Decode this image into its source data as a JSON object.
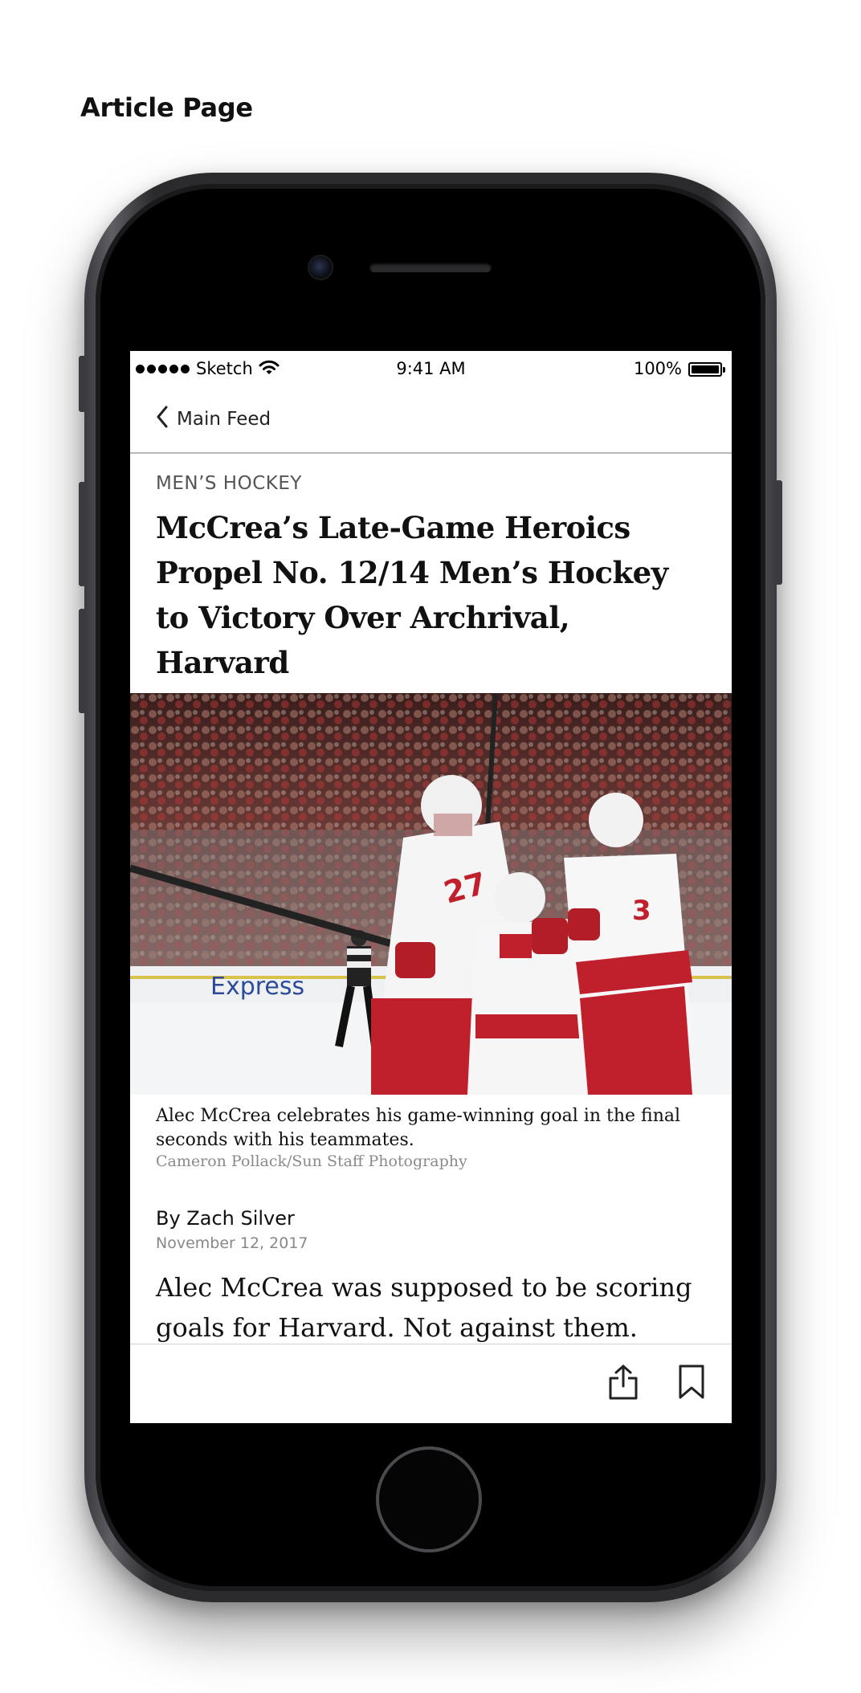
{
  "page_heading": "Article Page",
  "status_bar": {
    "carrier": "Sketch",
    "time": "9:41 AM",
    "battery": "100%",
    "battery_level": 1.0
  },
  "nav": {
    "back_label": "Main Feed",
    "back_icon": "chevron-left-icon"
  },
  "article": {
    "section": "MEN’S HOCKEY",
    "headline": "McCrea’s Late-Game Heroics Propel No. 12/14 Men’s Hockey to Victory Over Archrival, Harvard",
    "photo_caption": "Alec McCrea celebrates his game-winning goal in the final seconds with his teammates.",
    "photo_credit": "Cameron Pollack/Sun Staff Photography",
    "photo_jersey_numbers": [
      "27",
      "3"
    ],
    "rink_board_text": "Express",
    "byline": "By Zach Silver",
    "date": "November 12, 2017",
    "body": "Alec McCrea was supposed to be scoring goals for Harvard. Not against them."
  },
  "toolbar": {
    "share_icon": "share-icon",
    "bookmark_icon": "bookmark-icon"
  },
  "colors": {
    "device_frame": "#2b2b2e",
    "team_red": "#c0202b",
    "divider": "#b9b9b9"
  }
}
